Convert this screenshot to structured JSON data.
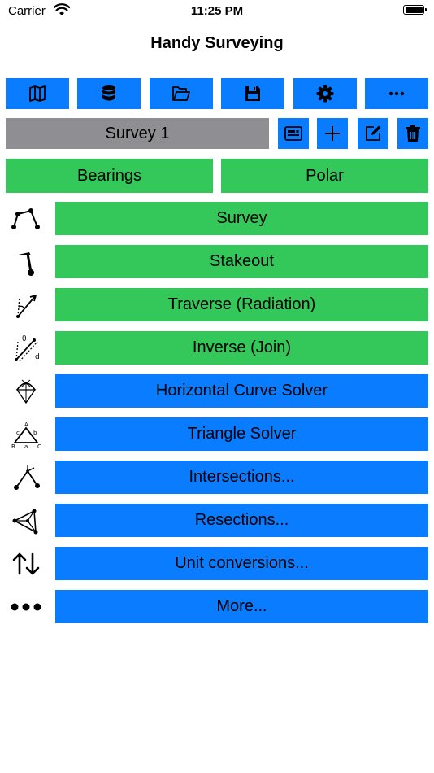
{
  "status_bar": {
    "carrier": "Carrier",
    "time": "11:25 PM"
  },
  "header": {
    "title": "Handy Surveying"
  },
  "toolbar": {
    "buttons": [
      {
        "icon": "map-icon"
      },
      {
        "icon": "database-icon"
      },
      {
        "icon": "folder-open-icon"
      },
      {
        "icon": "save-icon"
      },
      {
        "icon": "gear-icon"
      },
      {
        "icon": "ellipsis-icon"
      }
    ]
  },
  "survey": {
    "name": "Survey 1",
    "actions": [
      "details-icon",
      "plus-icon",
      "edit-icon",
      "trash-icon"
    ]
  },
  "modes": {
    "bearings_label": "Bearings",
    "polar_label": "Polar"
  },
  "menu": [
    {
      "label": "Survey",
      "color": "#34c759",
      "icon": "survey-icon"
    },
    {
      "label": "Stakeout",
      "color": "#34c759",
      "icon": "stakeout-icon"
    },
    {
      "label": "Traverse (Radiation)",
      "color": "#34c759",
      "icon": "traverse-icon"
    },
    {
      "label": "Inverse (Join)",
      "color": "#34c759",
      "icon": "inverse-icon"
    },
    {
      "label": "Horizontal Curve Solver",
      "color": "#0a7cff",
      "icon": "curve-icon"
    },
    {
      "label": "Triangle Solver",
      "color": "#0a7cff",
      "icon": "triangle-icon"
    },
    {
      "label": "Intersections...",
      "color": "#0a7cff",
      "icon": "intersections-icon"
    },
    {
      "label": "Resections...",
      "color": "#0a7cff",
      "icon": "resections-icon"
    },
    {
      "label": "Unit conversions...",
      "color": "#0a7cff",
      "icon": "unit-conversion-icon"
    },
    {
      "label": "More...",
      "color": "#0a7cff",
      "icon": "more-dots-icon"
    }
  ],
  "colors": {
    "accent_blue": "#0a7cff",
    "accent_green": "#34c759",
    "gray": "#8e8e93"
  }
}
